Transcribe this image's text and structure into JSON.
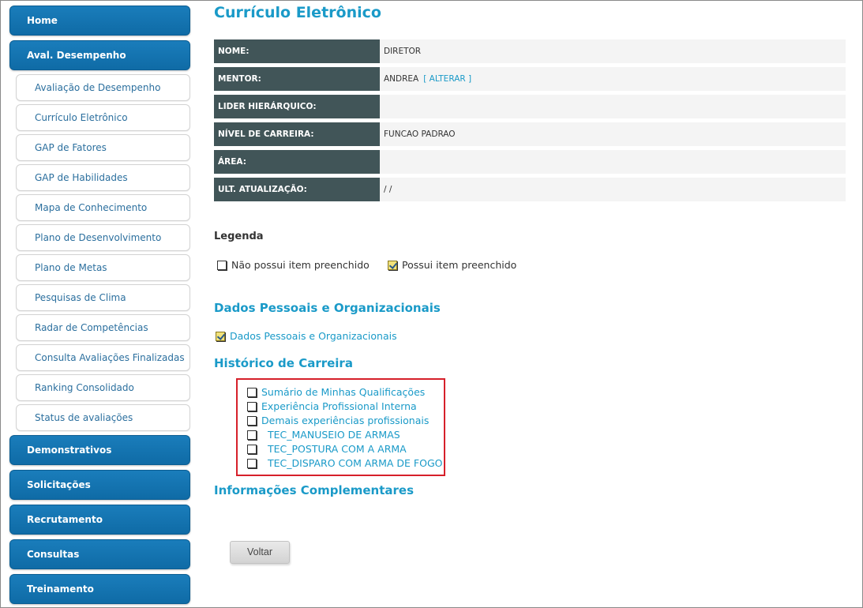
{
  "sidebar": {
    "home": "Home",
    "aval_desempenho": "Aval. Desempenho",
    "sub_items": [
      "Avaliação de Desempenho",
      "Currículo Eletrônico",
      "GAP de Fatores",
      "GAP de Habilidades",
      "Mapa de Conhecimento",
      "Plano de Desenvolvimento",
      "Plano de Metas",
      "Pesquisas de Clima",
      "Radar de Competências",
      "Consulta Avaliações Finalizadas",
      "Ranking Consolidado",
      "Status de avaliações"
    ],
    "demonstrativos": "Demonstrativos",
    "solicitacoes": "Solicitações",
    "recrutamento": "Recrutamento",
    "consultas": "Consultas",
    "treinamento": "Treinamento"
  },
  "page": {
    "title": "Currículo Eletrônico"
  },
  "info": {
    "nome_label": "NOME:",
    "nome_value": "DIRETOR",
    "mentor_label": "MENTOR:",
    "mentor_value": "ANDREA",
    "mentor_link": "[ ALTERAR ]",
    "lider_label": "LIDER HIERÁRQUICO:",
    "lider_value": "",
    "nivel_label": "NÍVEL DE CARREIRA:",
    "nivel_value": "FUNCAO PADRAO",
    "area_label": "ÁREA:",
    "area_value": "",
    "ult_label": "ULT. ATUALIZAÇÃO:",
    "ult_value": "/ /"
  },
  "legend": {
    "title": "Legenda",
    "unchecked": "Não possui item preenchido",
    "checked": "Possui item preenchido"
  },
  "dados": {
    "title": "Dados Pessoais e Organizacionais",
    "item": "Dados Pessoais e Organizacionais"
  },
  "historico": {
    "title": "Histórico de Carreira",
    "items": [
      "Sumário de Minhas Qualificações",
      "Experiência Profissional Interna",
      "Demais experiências profissionais",
      "TEC_MANUSEIO DE ARMAS",
      "TEC_POSTURA COM A ARMA",
      "TEC_DISPARO COM ARMA DE FOGO"
    ]
  },
  "complementares": {
    "title": "Informações Complementares"
  },
  "actions": {
    "back": "Voltar"
  },
  "colors": {
    "nav_blue": "#1a7dbb",
    "accent": "#1a9ac8",
    "label_bg": "#415558",
    "highlight": "#d6202a"
  }
}
